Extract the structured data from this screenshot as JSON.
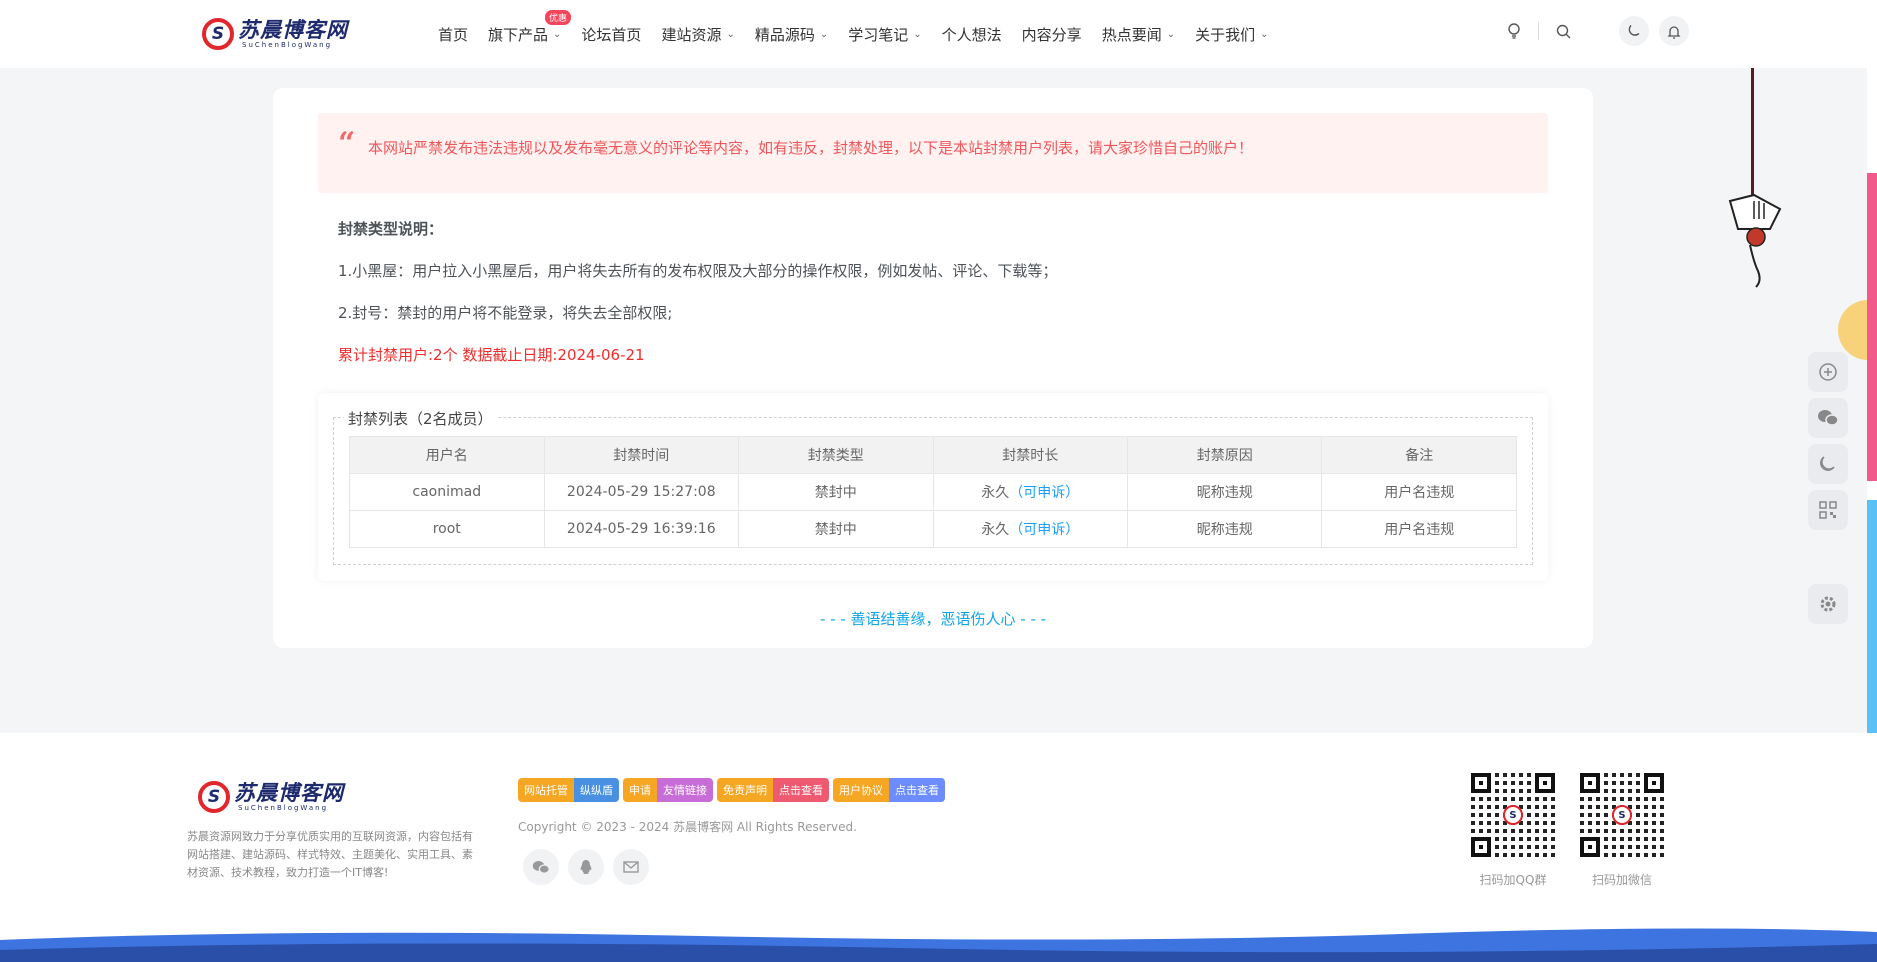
{
  "header": {
    "logo_cn": "苏晨博客网",
    "logo_en": "SuChenBlogWang",
    "logo_mark": "S",
    "nav": [
      {
        "label": "首页",
        "has_dropdown": false
      },
      {
        "label": "旗下产品",
        "has_dropdown": true,
        "badge": "优惠"
      },
      {
        "label": "论坛首页",
        "has_dropdown": false
      },
      {
        "label": "建站资源",
        "has_dropdown": true
      },
      {
        "label": "精品源码",
        "has_dropdown": true
      },
      {
        "label": "学习笔记",
        "has_dropdown": true
      },
      {
        "label": "个人想法",
        "has_dropdown": false
      },
      {
        "label": "内容分享",
        "has_dropdown": false
      },
      {
        "label": "热点要闻",
        "has_dropdown": true
      },
      {
        "label": "关于我们",
        "has_dropdown": true
      }
    ],
    "icons": [
      "lightbulb-icon",
      "search-icon",
      "moon-icon",
      "bell-icon"
    ]
  },
  "notice": {
    "text": "本网站严禁发布违法违规以及发布毫无意义的评论等内容，如有违反，封禁处理，以下是本站封禁用户列表，请大家珍惜自己的账户！"
  },
  "description": {
    "heading": "封禁类型说明：",
    "line1": "1.小黑屋：用户拉入小黑屋后，用户将失去所有的发布权限及大部分的操作权限，例如发帖、评论、下载等；",
    "line2": "2.封号：禁封的用户将不能登录，将失去全部权限;",
    "stats": "累计封禁用户:2个 数据截止日期:2024-06-21"
  },
  "banlist": {
    "legend": "封禁列表（2名成员）",
    "columns": [
      "用户名",
      "封禁时间",
      "封禁类型",
      "封禁时长",
      "封禁原因",
      "备注"
    ],
    "rows": [
      {
        "user": "caonimad",
        "time": "2024-05-29 15:27:08",
        "type": "禁封中",
        "duration": "永久",
        "appeal": "（可申诉）",
        "reason": "昵称违规",
        "note": "用户名违规"
      },
      {
        "user": "root",
        "time": "2024-05-29 16:39:16",
        "type": "禁封中",
        "duration": "永久",
        "appeal": "（可申诉）",
        "reason": "昵称违规",
        "note": "用户名违规"
      }
    ]
  },
  "motto": "- - - 善语结善缘，恶语伤人心 - - -",
  "footer": {
    "description": "苏晨资源网致力于分享优质实用的互联网资源，内容包括有网站搭建、建站源码、样式特效、主题美化、实用工具、素材资源、技术教程，致力打造一个IT博客!",
    "badges": [
      {
        "left": "网站托管",
        "right": "纵纵盾",
        "left_color": "#f5a623",
        "right_color": "#4a90e2"
      },
      {
        "left": "申请",
        "right": "友情链接",
        "left_color": "#f5a623",
        "right_color": "#c86dd7"
      },
      {
        "left": "免责声明",
        "right": "点击查看",
        "left_color": "#f5a623",
        "right_color": "#ee5a6f"
      },
      {
        "left": "用户协议",
        "right": "点击查看",
        "left_color": "#f5a623",
        "right_color": "#6c8cff"
      }
    ],
    "copyright": "Copyright © 2023 - 2024 苏晨博客网 All Rights Reserved.",
    "qr1_caption": "扫码加QQ群",
    "qr2_caption": "扫码加微信"
  },
  "colors": {
    "accent_red": "#f0565a",
    "link_blue": "#1e9fff",
    "motto_blue": "#0ea5e9",
    "brand_navy": "#1d2a6d"
  }
}
